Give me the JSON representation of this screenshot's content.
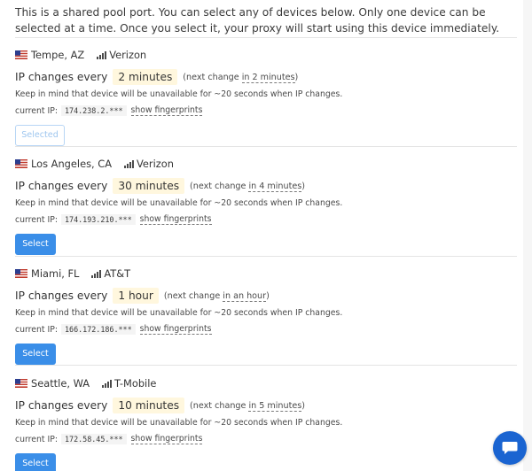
{
  "intro_text": "This is a shared pool port. You can select any of devices below. Only one device can be selected at a time. Once you select it, your proxy will start using this device immediately.",
  "ip_changes_label": "IP changes every",
  "next_change_prefix": "(next change ",
  "next_change_suffix": ")",
  "note": "Keep in mind that device will be unavailable for ~20 seconds when IP changes.",
  "current_ip_label": "current IP:",
  "show_fingerprints_label": "show fingerprints",
  "devices": [
    {
      "location": "Tempe, AZ",
      "carrier": "Verizon",
      "period": "2 minutes",
      "next_change": "in 2 minutes",
      "ip": "174.238.2.***",
      "button": "Selected",
      "selected": true
    },
    {
      "location": "Los Angeles, CA",
      "carrier": "Verizon",
      "period": "30 minutes",
      "next_change": "in 4 minutes",
      "ip": "174.193.210.***",
      "button": "Select",
      "selected": false
    },
    {
      "location": "Miami, FL",
      "carrier": "AT&T",
      "period": "1 hour",
      "next_change": "in an hour",
      "ip": "166.172.186.***",
      "button": "Select",
      "selected": false
    },
    {
      "location": "Seattle, WA",
      "carrier": "T-Mobile",
      "period": "10 minutes",
      "next_change": "in 5 minutes",
      "ip": "172.58.45.***",
      "button": "Select",
      "selected": false
    }
  ],
  "colors": {
    "accent": "#3a8ee8",
    "highlight": "#fff7de",
    "chat": "#1a64d1"
  },
  "icons": {
    "flag": "us-flag-icon",
    "signal": "signal-bars-icon",
    "chat": "chat-bubble-icon"
  }
}
